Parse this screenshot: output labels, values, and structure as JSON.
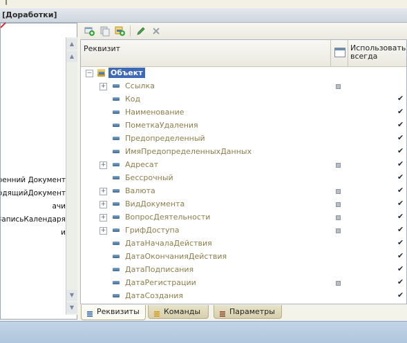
{
  "window": {
    "title": "[Доработки]"
  },
  "left_panel": {
    "items": [
      "тренний Документ",
      "ходящийДокумент",
      "ачи",
      "ьЗаписьКалендаря",
      "и"
    ]
  },
  "grid": {
    "headers": {
      "attribute": "Реквизит",
      "use_always": "Использовать всегда"
    },
    "object_label": "Объект",
    "rows": [
      {
        "label": "Ссылка",
        "expandable": true,
        "marker": true,
        "checked": false
      },
      {
        "label": "Код",
        "expandable": false,
        "marker": false,
        "checked": true
      },
      {
        "label": "Наименование",
        "expandable": false,
        "marker": false,
        "checked": true
      },
      {
        "label": "ПометкаУдаления",
        "expandable": false,
        "marker": false,
        "checked": true
      },
      {
        "label": "Предопределенный",
        "expandable": false,
        "marker": false,
        "checked": true
      },
      {
        "label": "ИмяПредопределенныхДанных",
        "expandable": false,
        "marker": false,
        "checked": true
      },
      {
        "label": "Адресат",
        "expandable": true,
        "marker": true,
        "checked": true
      },
      {
        "label": "Бессрочный",
        "expandable": false,
        "marker": false,
        "checked": true
      },
      {
        "label": "Валюта",
        "expandable": true,
        "marker": true,
        "checked": true
      },
      {
        "label": "ВидДокумента",
        "expandable": true,
        "marker": true,
        "checked": true
      },
      {
        "label": "ВопросДеятельности",
        "expandable": true,
        "marker": true,
        "checked": true
      },
      {
        "label": "ГрифДоступа",
        "expandable": true,
        "marker": true,
        "checked": true
      },
      {
        "label": "ДатаНачалаДействия",
        "expandable": false,
        "marker": false,
        "checked": true
      },
      {
        "label": "ДатаОкончанияДействия",
        "expandable": false,
        "marker": false,
        "checked": true
      },
      {
        "label": "ДатаПодписания",
        "expandable": false,
        "marker": false,
        "checked": true
      },
      {
        "label": "ДатаРегистрации",
        "expandable": false,
        "marker": true,
        "checked": true
      },
      {
        "label": "ДатаСоздания",
        "expandable": false,
        "marker": false,
        "checked": true
      }
    ]
  },
  "tabs": [
    {
      "label": "Реквизиты",
      "icon": "attributes-icon",
      "color": "#4a78b0"
    },
    {
      "label": "Команды",
      "icon": "commands-icon",
      "color": "#d8a020"
    },
    {
      "label": "Параметры",
      "icon": "parameters-icon",
      "color": "#9a5a3a"
    }
  ],
  "colors": {
    "selection": "#3d69b7",
    "attribute_text": "#8b7d4b",
    "status_bar": "#aec6de"
  }
}
